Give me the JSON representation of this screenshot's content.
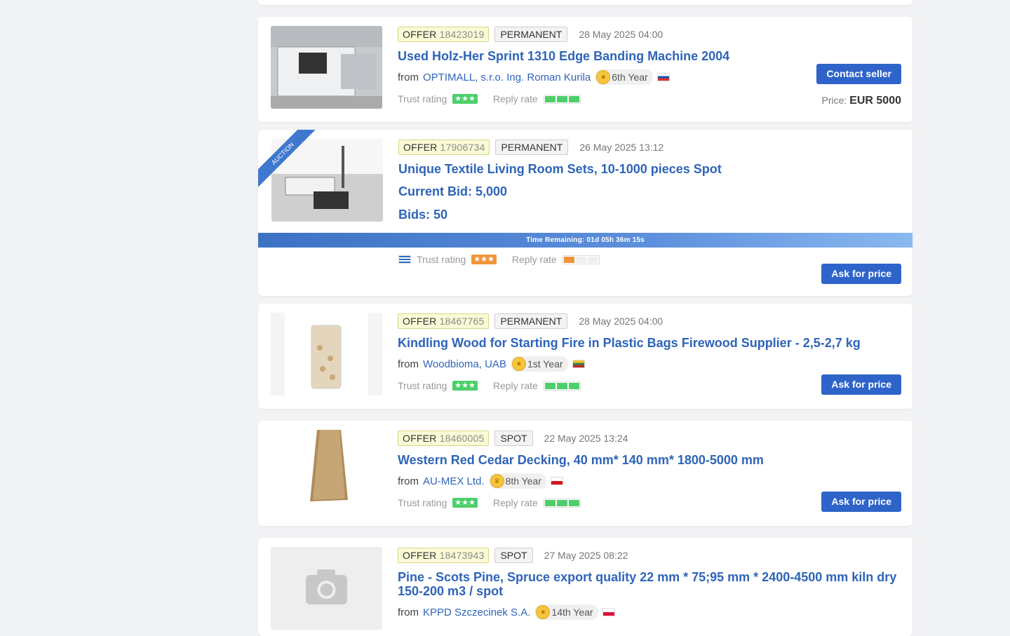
{
  "cards": [
    {
      "offer_label": "OFFER",
      "offer_num": "18423019",
      "type": "PERMANENT",
      "date": "28 May 2025 04:00",
      "title": "Used Holz-Her Sprint 1310 Edge Banding Machine 2004",
      "from_label": "from",
      "company": "OPTIMALL, s.r.o. Ing. Roman Kurila",
      "year": "6th Year",
      "trust_label": "Trust rating",
      "reply_label": "Reply rate",
      "button": "Contact seller",
      "price_label": "Price:",
      "price_value": "EUR 5000"
    },
    {
      "ribbon": "AUCTION",
      "offer_label": "OFFER",
      "offer_num": "17906734",
      "type": "PERMANENT",
      "date": "26 May 2025 13:12",
      "title": "Unique Textile Living Room Sets, 10-1000 pieces Spot",
      "current_bid": "Current Bid: 5,000",
      "bids": "Bids: 50",
      "time_remaining": "Time Remaining: 01d 05h 36m 15s",
      "trust_label": "Trust rating",
      "reply_label": "Reply rate",
      "button": "Ask for price"
    },
    {
      "offer_label": "OFFER",
      "offer_num": "18467765",
      "type": "PERMANENT",
      "date": "28 May 2025 04:00",
      "title": "Kindling Wood for Starting Fire in Plastic Bags Firewood Supplier - 2,5-2,7 kg",
      "from_label": "from",
      "company": "Woodbioma, UAB",
      "year": "1st Year",
      "trust_label": "Trust rating",
      "reply_label": "Reply rate",
      "button": "Ask for price"
    },
    {
      "offer_label": "OFFER",
      "offer_num": "18460005",
      "type": "SPOT",
      "date": "22 May 2025 13:24",
      "title": "Western Red Cedar Decking, 40 mm* 140 mm* 1800-5000 mm",
      "from_label": "from",
      "company": "AU-MEX Ltd.",
      "year": "8th Year",
      "trust_label": "Trust rating",
      "reply_label": "Reply rate",
      "button": "Ask for price"
    },
    {
      "offer_label": "OFFER",
      "offer_num": "18473943",
      "type": "SPOT",
      "date": "27 May 2025 08:22",
      "title_line1": "Pine - Scots Pine, Spruce export quality 22 mm * 75;95 mm * 2400-4500 mm kiln dry",
      "title_line2": "150-200 m3 / spot",
      "from_label": "from",
      "company": "KPPD Szczecinek S.A.",
      "year": "14th Year"
    }
  ],
  "colors": {
    "link": "#2e64b8",
    "button": "#2e64c9",
    "green_rating": "#4ccf6a",
    "orange_rating": "#f0963a"
  }
}
